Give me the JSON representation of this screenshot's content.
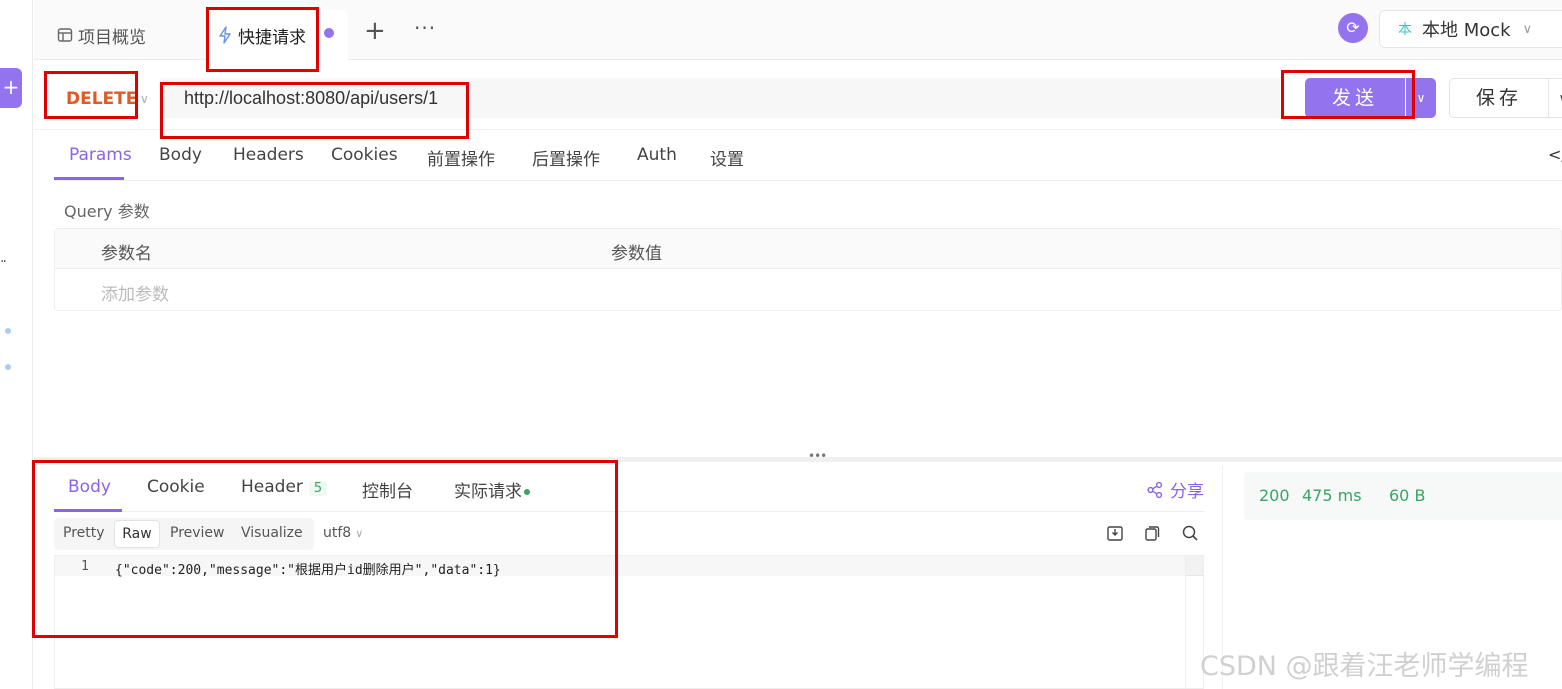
{
  "tabs": {
    "overview_label": "项目概览",
    "quick_request_label": "快捷请求",
    "plus_label": "+",
    "more_label": "···"
  },
  "env": {
    "badge": "本",
    "name": "本地 Mock"
  },
  "request": {
    "method": "DELETE",
    "url": "http://localhost:8080/api/users/1",
    "send_label": "发送",
    "save_label": "保存"
  },
  "req_tabs": {
    "params": "Params",
    "body": "Body",
    "headers": "Headers",
    "cookies": "Cookies",
    "pre": "前置操作",
    "post": "后置操作",
    "auth": "Auth",
    "settings": "设置",
    "code_toggle": "</"
  },
  "query": {
    "title": "Query 参数",
    "col_name": "参数名",
    "col_value": "参数值",
    "add_placeholder": "添加参数"
  },
  "response": {
    "tabs": {
      "body": "Body",
      "cookie": "Cookie",
      "header": "Header",
      "header_count": "5",
      "console": "控制台",
      "actual": "实际请求"
    },
    "share_label": "分享",
    "formats": {
      "pretty": "Pretty",
      "raw": "Raw",
      "preview": "Preview",
      "visualize": "Visualize"
    },
    "encoding": "utf8",
    "line_number": "1",
    "body_text": "{\"code\":200,\"message\":\"根据用户id删除用户\",\"data\":1}",
    "status_code": "200",
    "time": "475 ms",
    "size": "60 B"
  },
  "watermark": "CSDN @跟着汪老师学编程",
  "colors": {
    "accent": "#9373ee",
    "method_delete": "#e05a28",
    "success": "#3aa463",
    "annotation": "#e00000"
  }
}
